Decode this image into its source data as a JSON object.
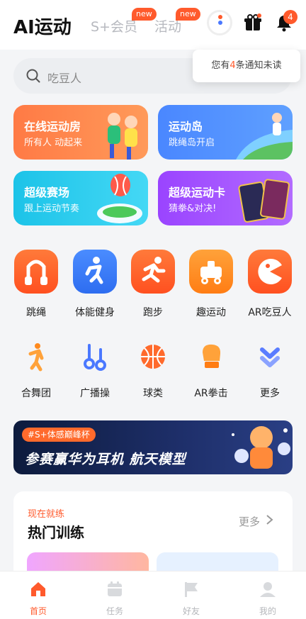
{
  "header": {
    "brand": "AI运动",
    "tabs": [
      {
        "label": "S+会员",
        "badge": "new"
      },
      {
        "label": "活动",
        "badge": "new"
      }
    ],
    "notification_count": "4"
  },
  "tooltip": {
    "prefix": "您有",
    "count": "4",
    "suffix": "条通知未读"
  },
  "search": {
    "placeholder": "吃豆人"
  },
  "feature_cards": [
    {
      "title": "在线运动房",
      "subtitle": "所有人 动起来"
    },
    {
      "title": "运动岛",
      "subtitle": "跳绳岛开启"
    },
    {
      "title": "超级赛场",
      "subtitle": "跟上运动节奏"
    },
    {
      "title": "超级运动卡",
      "subtitle": "猜拳&对决!"
    }
  ],
  "sports_primary": [
    {
      "label": "跳绳",
      "icon": "jump-rope-icon"
    },
    {
      "label": "体能健身",
      "icon": "fitness-icon"
    },
    {
      "label": "跑步",
      "icon": "running-icon"
    },
    {
      "label": "趣运动",
      "icon": "fun-sport-icon"
    },
    {
      "label": "AR吃豆人",
      "icon": "pacman-icon"
    }
  ],
  "sports_secondary": [
    {
      "label": "合舞团",
      "icon": "dance-icon"
    },
    {
      "label": "广播操",
      "icon": "broadcast-exercise-icon"
    },
    {
      "label": "球类",
      "icon": "ball-icon"
    },
    {
      "label": "AR拳击",
      "icon": "boxing-glove-icon"
    },
    {
      "label": "更多",
      "icon": "more-chevron-icon"
    }
  ],
  "banner": {
    "tag": "#S+体感巅峰杯",
    "headline": "参赛赢华为耳机 航天模型"
  },
  "hot_training": {
    "kicker": "现在就练",
    "title": "热门训练",
    "more": "更多"
  },
  "tabbar": [
    {
      "label": "首页",
      "active": true
    },
    {
      "label": "任务",
      "active": false
    },
    {
      "label": "好友",
      "active": false
    },
    {
      "label": "我的",
      "active": false
    }
  ],
  "colors": {
    "accent": "#ff5a2c",
    "blue": "#4a87ff",
    "cyan": "#1cc3e8",
    "purple": "#9a44ff"
  }
}
